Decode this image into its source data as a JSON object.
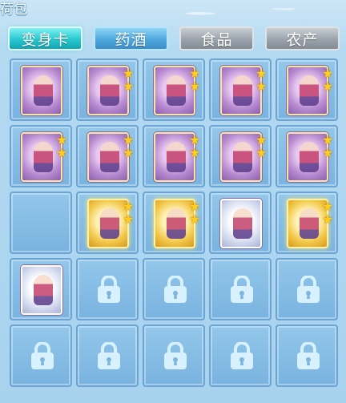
{
  "window": {
    "title": "荷包"
  },
  "tabs": [
    {
      "label": "变身卡",
      "state": "active"
    },
    {
      "label": "药酒",
      "state": "blue"
    },
    {
      "label": "食品",
      "state": "grey"
    },
    {
      "label": "农产",
      "state": "grey"
    }
  ],
  "slots": [
    {
      "type": "card",
      "frame": "purple",
      "stars": 0
    },
    {
      "type": "card",
      "frame": "purple",
      "stars": 2
    },
    {
      "type": "card",
      "frame": "purple",
      "stars": 2
    },
    {
      "type": "card",
      "frame": "purple",
      "stars": 2
    },
    {
      "type": "card",
      "frame": "purple",
      "stars": 2
    },
    {
      "type": "card",
      "frame": "purple",
      "stars": 2
    },
    {
      "type": "card",
      "frame": "purple",
      "stars": 2
    },
    {
      "type": "card",
      "frame": "purple",
      "stars": 2
    },
    {
      "type": "card",
      "frame": "purple",
      "stars": 2
    },
    {
      "type": "card",
      "frame": "purple",
      "stars": 2
    },
    {
      "type": "empty"
    },
    {
      "type": "card",
      "frame": "gold",
      "stars": 2
    },
    {
      "type": "card",
      "frame": "gold",
      "stars": 2
    },
    {
      "type": "card",
      "frame": "silver",
      "stars": 0
    },
    {
      "type": "card",
      "frame": "gold",
      "stars": 2
    },
    {
      "type": "card",
      "frame": "silver",
      "stars": 0
    },
    {
      "type": "locked"
    },
    {
      "type": "locked"
    },
    {
      "type": "locked"
    },
    {
      "type": "locked"
    },
    {
      "type": "locked"
    },
    {
      "type": "locked"
    },
    {
      "type": "locked"
    },
    {
      "type": "locked"
    },
    {
      "type": "locked"
    }
  ],
  "colors": {
    "star": "#ffcf1f",
    "lock": "#d8f1ff",
    "tab_active": "#27c7cf",
    "tab_blue": "#4ea8de",
    "tab_grey": "#9aa2ab"
  },
  "icons": {
    "star": "star-icon",
    "lock": "lock-icon"
  }
}
